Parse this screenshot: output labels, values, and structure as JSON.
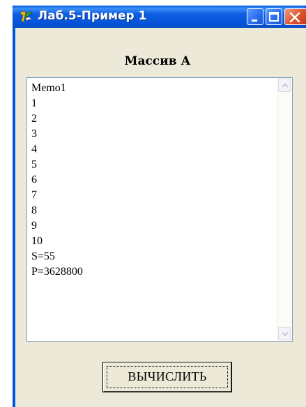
{
  "window": {
    "title": "Лаб.5-Пример 1",
    "icon": "delphi-app-icon",
    "controls": [
      "minimize-icon",
      "maximize-icon",
      "close-icon"
    ]
  },
  "form": {
    "heading": "Массив А",
    "memo": {
      "lines": [
        "Memo1",
        "1",
        "2",
        "3",
        "4",
        "5",
        "6",
        "7",
        "8",
        "9",
        "10",
        "S=55",
        "P=3628800"
      ]
    },
    "button_label": "ВЫЧИСЛИТЬ"
  },
  "colors": {
    "titlebar": "#0054e3",
    "form_background": "#ece9d8",
    "close_button": "#e0532e"
  }
}
